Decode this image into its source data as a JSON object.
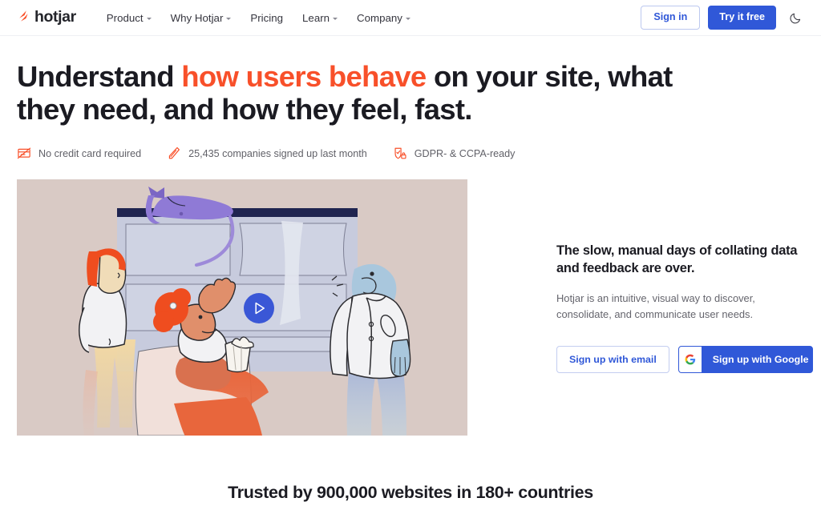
{
  "header": {
    "logo": {
      "text": "hotjar",
      "icon": "hotjar-bolt-icon",
      "accent_color": "#f8502a"
    },
    "nav": [
      {
        "label": "Product",
        "has_dropdown": true
      },
      {
        "label": "Why Hotjar",
        "has_dropdown": true
      },
      {
        "label": "Pricing",
        "has_dropdown": false
      },
      {
        "label": "Learn",
        "has_dropdown": true
      },
      {
        "label": "Company",
        "has_dropdown": true
      }
    ],
    "sign_in_label": "Sign in",
    "try_free_label": "Try it free",
    "theme_toggle_icon": "moon-icon"
  },
  "hero": {
    "headline_part1": "Understand ",
    "headline_accent": "how users behave",
    "headline_part2": " on your site, what they need, and how they feel, fast.",
    "badges": [
      {
        "icon": "no-credit-card-icon",
        "label": "No credit card required"
      },
      {
        "icon": "pen-icon",
        "label": "25,435 companies signed up last month"
      },
      {
        "icon": "shield-lock-icon",
        "label": "GDPR- & CCPA-ready"
      }
    ]
  },
  "video": {
    "name": "hero-illustration-video",
    "play_icon": "play-icon",
    "background_color": "#d9cac5",
    "play_button_color": "#3a57d6"
  },
  "promo": {
    "heading": "The slow, manual days of collating data and feedback are over.",
    "body": "Hotjar is an intuitive, visual way to discover, consolidate, and communicate user needs.",
    "sign_up_email_label": "Sign up with email",
    "sign_up_google_label": "Sign up with Google",
    "google_icon": "google-g-icon"
  },
  "trusted": {
    "text": "Trusted by 900,000 websites in 180+ countries"
  },
  "colors": {
    "brand_orange": "#f8502a",
    "brand_blue": "#3058d8",
    "text_dark": "#1b1b22",
    "text_muted": "#65656d"
  }
}
